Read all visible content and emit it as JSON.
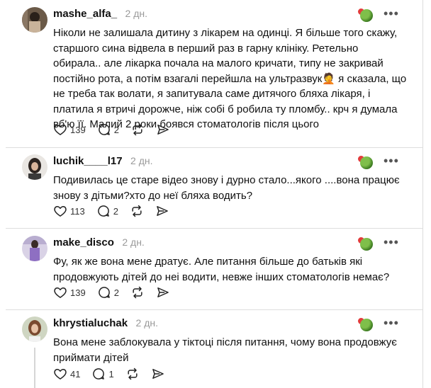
{
  "posts": [
    {
      "username": "mashe_alfa_",
      "time": "2 дн.",
      "text": "Ніколи не залишала дитину з лікарем на одинці. Я більше того скажу, старшого сина відвела в перший раз в гарну клініку. Ретельно обирала.. але лікарка почала на малого кричати, типу не закривай постійно рота, а потім взагалі перейшла на ультразвук🤦 я сказала, що не треба так волати, я запитувала саме дитячого бляха лікаря, і платила я втричі дорожче, ніж собі б робила ту пломбу.. крч я думала вб'ю її. Малий 2 роки боявся стоматологів після цього",
      "likes": "139",
      "replies": "2"
    },
    {
      "username": "luchik____l17",
      "time": "2 дн.",
      "text": "Подивилась це старе відео знову і дурно стало...якого ....вона працює знову з дітьми?хто до неї бляха водить?",
      "likes": "113",
      "replies": "2"
    },
    {
      "username": "make_disco",
      "time": "2 дн.",
      "text": "Фу, як же вона мене дратує. Але питання більше до батьків які продовжують дітей до неі водити, невже інших стоматологів немає?",
      "likes": "139",
      "replies": "2"
    },
    {
      "username": "khrystialuchak",
      "time": "2 дн.",
      "text": "Вона мене заблокувала у тіктоці після питання, чому вона продовжує приймати дітей",
      "likes": "41",
      "replies": "1"
    }
  ],
  "icons": {
    "like": "heart-icon",
    "reply": "comment-icon",
    "repost": "repost-icon",
    "share": "send-icon",
    "badge": "globe-badge-icon",
    "more": "more-icon"
  },
  "colors": {
    "text": "#101010",
    "muted": "#999999",
    "divider": "#dedede"
  }
}
